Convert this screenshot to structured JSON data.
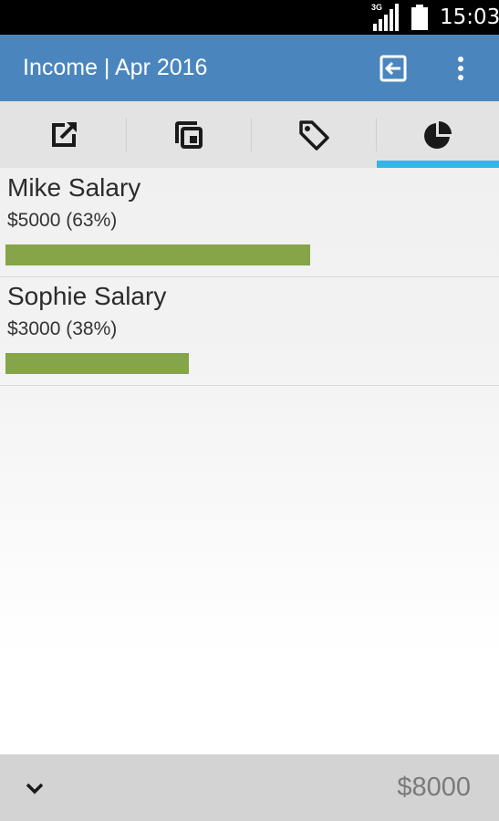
{
  "status_bar": {
    "network": "3G",
    "time": "15:03",
    "icons": [
      "signal-icon",
      "battery-icon"
    ]
  },
  "action_bar": {
    "title": "Income | Apr 2016",
    "actions": [
      {
        "name": "exit-icon",
        "label": ""
      },
      {
        "name": "overflow-menu-icon",
        "label": ""
      }
    ],
    "color": "#4a86bd"
  },
  "tabs": [
    {
      "icon": "share-external-icon",
      "selected": false
    },
    {
      "icon": "copy-icon",
      "selected": false
    },
    {
      "icon": "tag-icon",
      "selected": false
    },
    {
      "icon": "pie-chart-icon",
      "selected": true
    }
  ],
  "items": [
    {
      "name": "Mike Salary",
      "amount": "$5000 (63%)",
      "fraction": 0.63
    },
    {
      "name": "Sophie Salary",
      "amount": "$3000 (38%)",
      "fraction": 0.38
    }
  ],
  "footer": {
    "expand_icon": "chevron-down-icon",
    "total": "$8000"
  },
  "colors": {
    "accent": "#33b5e5",
    "bar": "#86a448",
    "header": "#4a86bd"
  }
}
